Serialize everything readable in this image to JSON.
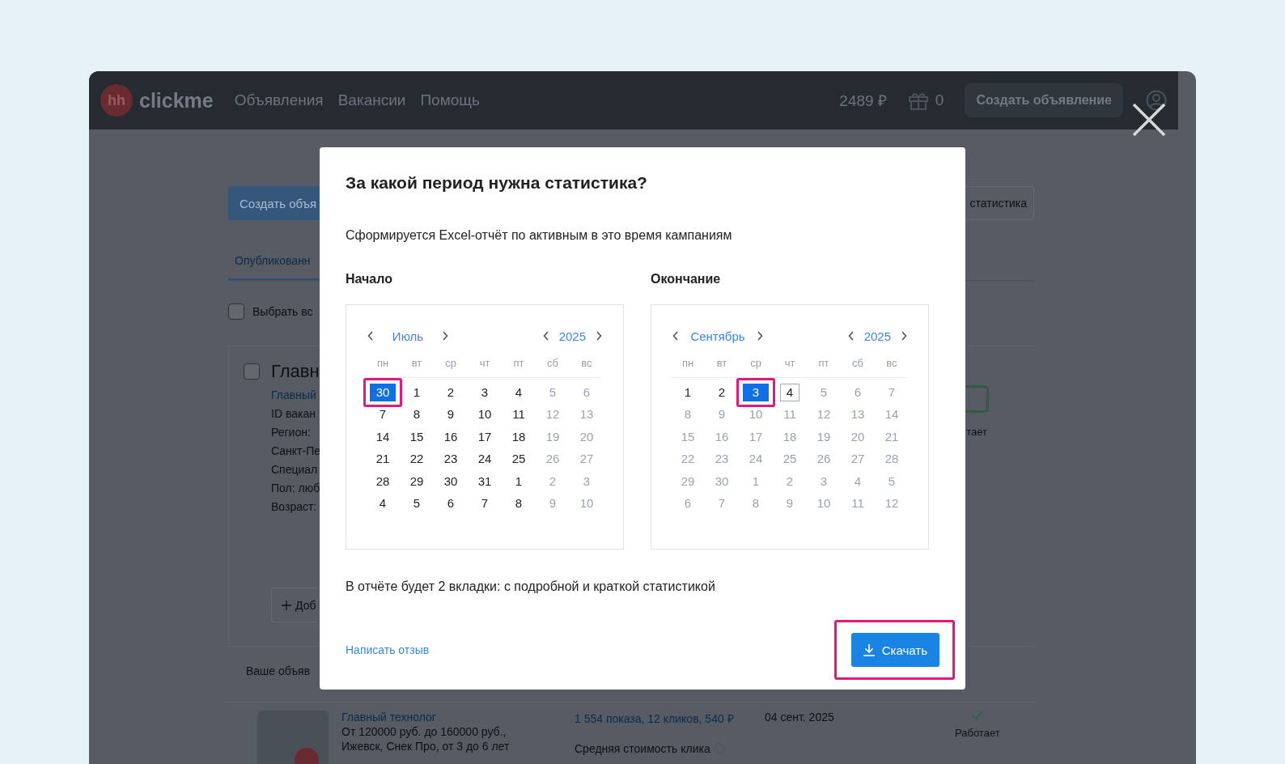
{
  "header": {
    "logo_mark": "hh",
    "logo_text": "clickme",
    "nav": [
      "Объявления",
      "Вакансии",
      "Помощь"
    ],
    "balance": "2489 ₽",
    "gifts": "0",
    "create_button": "Создать объявление"
  },
  "page": {
    "create_button": "Создать объя",
    "stats_button": "статистика",
    "tabs": [
      {
        "label": "Опубликованн",
        "selected": true
      }
    ],
    "select_all": {
      "label": "Выбрать вс",
      "checked": false
    },
    "card": {
      "checked": false,
      "title": "Главн",
      "link": "Главный",
      "lines": [
        "ID вакан",
        "Регион:",
        "Санкт-Пе",
        "Специал",
        "Пол: люб",
        "Возраст:"
      ],
      "add_button": "Доб",
      "status": "тает"
    },
    "section_title": "Ваше объяв",
    "ad": {
      "title": "Главный технолог",
      "lines": [
        "От 120000 руб. до 160000 руб.,",
        "Ижевск, Снек Про, от 3 до 6 лет"
      ],
      "stats": "1 554 показа, 12 кликов, 540 ₽",
      "avg_cost": "Средняя стоимость клика",
      "date": "04 сент. 2025",
      "status": "Работает"
    }
  },
  "modal": {
    "title": "За какой период нужна статистика?",
    "subtitle": "Сформируется Excel-отчёт по активным в это время кампаниям",
    "calendars": [
      {
        "label": "Начало",
        "month": "Июль",
        "year": "2025",
        "weekdays": [
          "пн",
          "вт",
          "ср",
          "чт",
          "пт",
          "сб",
          "вс"
        ],
        "weeks": [
          [
            {
              "day": "30",
              "muted": false,
              "selected": true,
              "outlined": false,
              "highlighted": true
            },
            {
              "day": "1",
              "muted": false,
              "selected": false,
              "outlined": false,
              "highlighted": false
            },
            {
              "day": "2",
              "muted": false,
              "selected": false,
              "outlined": false,
              "highlighted": false
            },
            {
              "day": "3",
              "muted": false,
              "selected": false,
              "outlined": false,
              "highlighted": false
            },
            {
              "day": "4",
              "muted": false,
              "selected": false,
              "outlined": false,
              "highlighted": false
            },
            {
              "day": "5",
              "muted": true,
              "selected": false,
              "outlined": false,
              "highlighted": false
            },
            {
              "day": "6",
              "muted": true,
              "selected": false,
              "outlined": false,
              "highlighted": false
            }
          ],
          [
            {
              "day": "7",
              "muted": false,
              "selected": false,
              "outlined": false,
              "highlighted": false
            },
            {
              "day": "8",
              "muted": false,
              "selected": false,
              "outlined": false,
              "highlighted": false
            },
            {
              "day": "9",
              "muted": false,
              "selected": false,
              "outlined": false,
              "highlighted": false
            },
            {
              "day": "10",
              "muted": false,
              "selected": false,
              "outlined": false,
              "highlighted": false
            },
            {
              "day": "11",
              "muted": false,
              "selected": false,
              "outlined": false,
              "highlighted": false
            },
            {
              "day": "12",
              "muted": true,
              "selected": false,
              "outlined": false,
              "highlighted": false
            },
            {
              "day": "13",
              "muted": true,
              "selected": false,
              "outlined": false,
              "highlighted": false
            }
          ],
          [
            {
              "day": "14",
              "muted": false,
              "selected": false,
              "outlined": false,
              "highlighted": false
            },
            {
              "day": "15",
              "muted": false,
              "selected": false,
              "outlined": false,
              "highlighted": false
            },
            {
              "day": "16",
              "muted": false,
              "selected": false,
              "outlined": false,
              "highlighted": false
            },
            {
              "day": "17",
              "muted": false,
              "selected": false,
              "outlined": false,
              "highlighted": false
            },
            {
              "day": "18",
              "muted": false,
              "selected": false,
              "outlined": false,
              "highlighted": false
            },
            {
              "day": "19",
              "muted": true,
              "selected": false,
              "outlined": false,
              "highlighted": false
            },
            {
              "day": "20",
              "muted": true,
              "selected": false,
              "outlined": false,
              "highlighted": false
            }
          ],
          [
            {
              "day": "21",
              "muted": false,
              "selected": false,
              "outlined": false,
              "highlighted": false
            },
            {
              "day": "22",
              "muted": false,
              "selected": false,
              "outlined": false,
              "highlighted": false
            },
            {
              "day": "23",
              "muted": false,
              "selected": false,
              "outlined": false,
              "highlighted": false
            },
            {
              "day": "24",
              "muted": false,
              "selected": false,
              "outlined": false,
              "highlighted": false
            },
            {
              "day": "25",
              "muted": false,
              "selected": false,
              "outlined": false,
              "highlighted": false
            },
            {
              "day": "26",
              "muted": true,
              "selected": false,
              "outlined": false,
              "highlighted": false
            },
            {
              "day": "27",
              "muted": true,
              "selected": false,
              "outlined": false,
              "highlighted": false
            }
          ],
          [
            {
              "day": "28",
              "muted": false,
              "selected": false,
              "outlined": false,
              "highlighted": false
            },
            {
              "day": "29",
              "muted": false,
              "selected": false,
              "outlined": false,
              "highlighted": false
            },
            {
              "day": "30",
              "muted": false,
              "selected": false,
              "outlined": false,
              "highlighted": false
            },
            {
              "day": "31",
              "muted": false,
              "selected": false,
              "outlined": false,
              "highlighted": false
            },
            {
              "day": "1",
              "muted": false,
              "selected": false,
              "outlined": false,
              "highlighted": false
            },
            {
              "day": "2",
              "muted": true,
              "selected": false,
              "outlined": false,
              "highlighted": false
            },
            {
              "day": "3",
              "muted": true,
              "selected": false,
              "outlined": false,
              "highlighted": false
            }
          ],
          [
            {
              "day": "4",
              "muted": false,
              "selected": false,
              "outlined": false,
              "highlighted": false
            },
            {
              "day": "5",
              "muted": false,
              "selected": false,
              "outlined": false,
              "highlighted": false
            },
            {
              "day": "6",
              "muted": false,
              "selected": false,
              "outlined": false,
              "highlighted": false
            },
            {
              "day": "7",
              "muted": false,
              "selected": false,
              "outlined": false,
              "highlighted": false
            },
            {
              "day": "8",
              "muted": false,
              "selected": false,
              "outlined": false,
              "highlighted": false
            },
            {
              "day": "9",
              "muted": true,
              "selected": false,
              "outlined": false,
              "highlighted": false
            },
            {
              "day": "10",
              "muted": true,
              "selected": false,
              "outlined": false,
              "highlighted": false
            }
          ]
        ]
      },
      {
        "label": "Окончание",
        "month": "Сентябрь",
        "year": "2025",
        "weekdays": [
          "пн",
          "вт",
          "ср",
          "чт",
          "пт",
          "сб",
          "вс"
        ],
        "weeks": [
          [
            {
              "day": "1",
              "muted": false,
              "selected": false,
              "outlined": false,
              "highlighted": false
            },
            {
              "day": "2",
              "muted": false,
              "selected": false,
              "outlined": false,
              "highlighted": false
            },
            {
              "day": "3",
              "muted": false,
              "selected": true,
              "outlined": false,
              "highlighted": true
            },
            {
              "day": "4",
              "muted": false,
              "selected": false,
              "outlined": true,
              "highlighted": false
            },
            {
              "day": "5",
              "muted": true,
              "selected": false,
              "outlined": false,
              "highlighted": false
            },
            {
              "day": "6",
              "muted": true,
              "selected": false,
              "outlined": false,
              "highlighted": false
            },
            {
              "day": "7",
              "muted": true,
              "selected": false,
              "outlined": false,
              "highlighted": false
            }
          ],
          [
            {
              "day": "8",
              "muted": true,
              "selected": false,
              "outlined": false,
              "highlighted": false
            },
            {
              "day": "9",
              "muted": true,
              "selected": false,
              "outlined": false,
              "highlighted": false
            },
            {
              "day": "10",
              "muted": true,
              "selected": false,
              "outlined": false,
              "highlighted": false
            },
            {
              "day": "11",
              "muted": true,
              "selected": false,
              "outlined": false,
              "highlighted": false
            },
            {
              "day": "12",
              "muted": true,
              "selected": false,
              "outlined": false,
              "highlighted": false
            },
            {
              "day": "13",
              "muted": true,
              "selected": false,
              "outlined": false,
              "highlighted": false
            },
            {
              "day": "14",
              "muted": true,
              "selected": false,
              "outlined": false,
              "highlighted": false
            }
          ],
          [
            {
              "day": "15",
              "muted": true,
              "selected": false,
              "outlined": false,
              "highlighted": false
            },
            {
              "day": "16",
              "muted": true,
              "selected": false,
              "outlined": false,
              "highlighted": false
            },
            {
              "day": "17",
              "muted": true,
              "selected": false,
              "outlined": false,
              "highlighted": false
            },
            {
              "day": "18",
              "muted": true,
              "selected": false,
              "outlined": false,
              "highlighted": false
            },
            {
              "day": "19",
              "muted": true,
              "selected": false,
              "outlined": false,
              "highlighted": false
            },
            {
              "day": "20",
              "muted": true,
              "selected": false,
              "outlined": false,
              "highlighted": false
            },
            {
              "day": "21",
              "muted": true,
              "selected": false,
              "outlined": false,
              "highlighted": false
            }
          ],
          [
            {
              "day": "22",
              "muted": true,
              "selected": false,
              "outlined": false,
              "highlighted": false
            },
            {
              "day": "23",
              "muted": true,
              "selected": false,
              "outlined": false,
              "highlighted": false
            },
            {
              "day": "24",
              "muted": true,
              "selected": false,
              "outlined": false,
              "highlighted": false
            },
            {
              "day": "25",
              "muted": true,
              "selected": false,
              "outlined": false,
              "highlighted": false
            },
            {
              "day": "26",
              "muted": true,
              "selected": false,
              "outlined": false,
              "highlighted": false
            },
            {
              "day": "27",
              "muted": true,
              "selected": false,
              "outlined": false,
              "highlighted": false
            },
            {
              "day": "28",
              "muted": true,
              "selected": false,
              "outlined": false,
              "highlighted": false
            }
          ],
          [
            {
              "day": "29",
              "muted": true,
              "selected": false,
              "outlined": false,
              "highlighted": false
            },
            {
              "day": "30",
              "muted": true,
              "selected": false,
              "outlined": false,
              "highlighted": false
            },
            {
              "day": "1",
              "muted": true,
              "selected": false,
              "outlined": false,
              "highlighted": false
            },
            {
              "day": "2",
              "muted": true,
              "selected": false,
              "outlined": false,
              "highlighted": false
            },
            {
              "day": "3",
              "muted": true,
              "selected": false,
              "outlined": false,
              "highlighted": false
            },
            {
              "day": "4",
              "muted": true,
              "selected": false,
              "outlined": false,
              "highlighted": false
            },
            {
              "day": "5",
              "muted": true,
              "selected": false,
              "outlined": false,
              "highlighted": false
            }
          ],
          [
            {
              "day": "6",
              "muted": true,
              "selected": false,
              "outlined": false,
              "highlighted": false
            },
            {
              "day": "7",
              "muted": true,
              "selected": false,
              "outlined": false,
              "highlighted": false
            },
            {
              "day": "8",
              "muted": true,
              "selected": false,
              "outlined": false,
              "highlighted": false
            },
            {
              "day": "9",
              "muted": true,
              "selected": false,
              "outlined": false,
              "highlighted": false
            },
            {
              "day": "10",
              "muted": true,
              "selected": false,
              "outlined": false,
              "highlighted": false
            },
            {
              "day": "11",
              "muted": true,
              "selected": false,
              "outlined": false,
              "highlighted": false
            },
            {
              "day": "12",
              "muted": true,
              "selected": false,
              "outlined": false,
              "highlighted": false
            }
          ]
        ]
      }
    ],
    "note": "В отчёте будет 2 вкладки: с подробной и краткой статистикой",
    "feedback_link": "Написать отзыв",
    "download_button": {
      "label": "Скачать",
      "highlighted": true
    }
  }
}
